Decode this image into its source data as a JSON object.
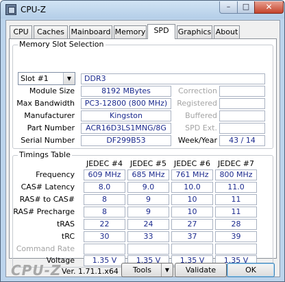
{
  "window": {
    "title": "CPU-Z",
    "min_glyph": "–",
    "max_glyph": "□",
    "close_glyph": "✕"
  },
  "tabs": [
    "CPU",
    "Caches",
    "Mainboard",
    "Memory",
    "SPD",
    "Graphics",
    "About"
  ],
  "active_tab": "SPD",
  "slot_section": {
    "title": "Memory Slot Selection",
    "selected_slot": "Slot #1",
    "memory_type": "DDR3",
    "fields": {
      "module_size": {
        "label": "Module Size",
        "value": "8192 MBytes"
      },
      "max_bandwidth": {
        "label": "Max Bandwidth",
        "value": "PC3-12800 (800 MHz)"
      },
      "manufacturer": {
        "label": "Manufacturer",
        "value": "Kingston"
      },
      "part_number": {
        "label": "Part Number",
        "value": "ACR16D3LS1MNG/8G"
      },
      "serial_number": {
        "label": "Serial Number",
        "value": "DF299B53"
      },
      "correction": {
        "label": "Correction",
        "value": ""
      },
      "registered": {
        "label": "Registered",
        "value": ""
      },
      "buffered": {
        "label": "Buffered",
        "value": ""
      },
      "spd_ext": {
        "label": "SPD Ext.",
        "value": ""
      },
      "week_year": {
        "label": "Week/Year",
        "value": "43 / 14"
      }
    }
  },
  "timings": {
    "title": "Timings Table",
    "columns": [
      "JEDEC #4",
      "JEDEC #5",
      "JEDEC #6",
      "JEDEC #7"
    ],
    "rows": [
      {
        "label": "Frequency",
        "values": [
          "609 MHz",
          "685 MHz",
          "761 MHz",
          "800 MHz"
        ]
      },
      {
        "label": "CAS# Latency",
        "values": [
          "8.0",
          "9.0",
          "10.0",
          "11.0"
        ]
      },
      {
        "label": "RAS# to CAS#",
        "values": [
          "8",
          "9",
          "10",
          "11"
        ]
      },
      {
        "label": "RAS# Precharge",
        "values": [
          "8",
          "9",
          "10",
          "11"
        ]
      },
      {
        "label": "tRAS",
        "values": [
          "22",
          "24",
          "27",
          "28"
        ]
      },
      {
        "label": "tRC",
        "values": [
          "30",
          "33",
          "37",
          "39"
        ]
      },
      {
        "label": "Command Rate",
        "values": [
          "",
          "",
          "",
          ""
        ]
      },
      {
        "label": "Voltage",
        "values": [
          "1.35 V",
          "1.35 V",
          "1.35 V",
          "1.35 V"
        ]
      }
    ]
  },
  "footer": {
    "logo": "CPU-Z",
    "version": "Ver. 1.71.1.x64",
    "tools_label": "Tools",
    "validate_label": "Validate",
    "ok_label": "OK"
  }
}
